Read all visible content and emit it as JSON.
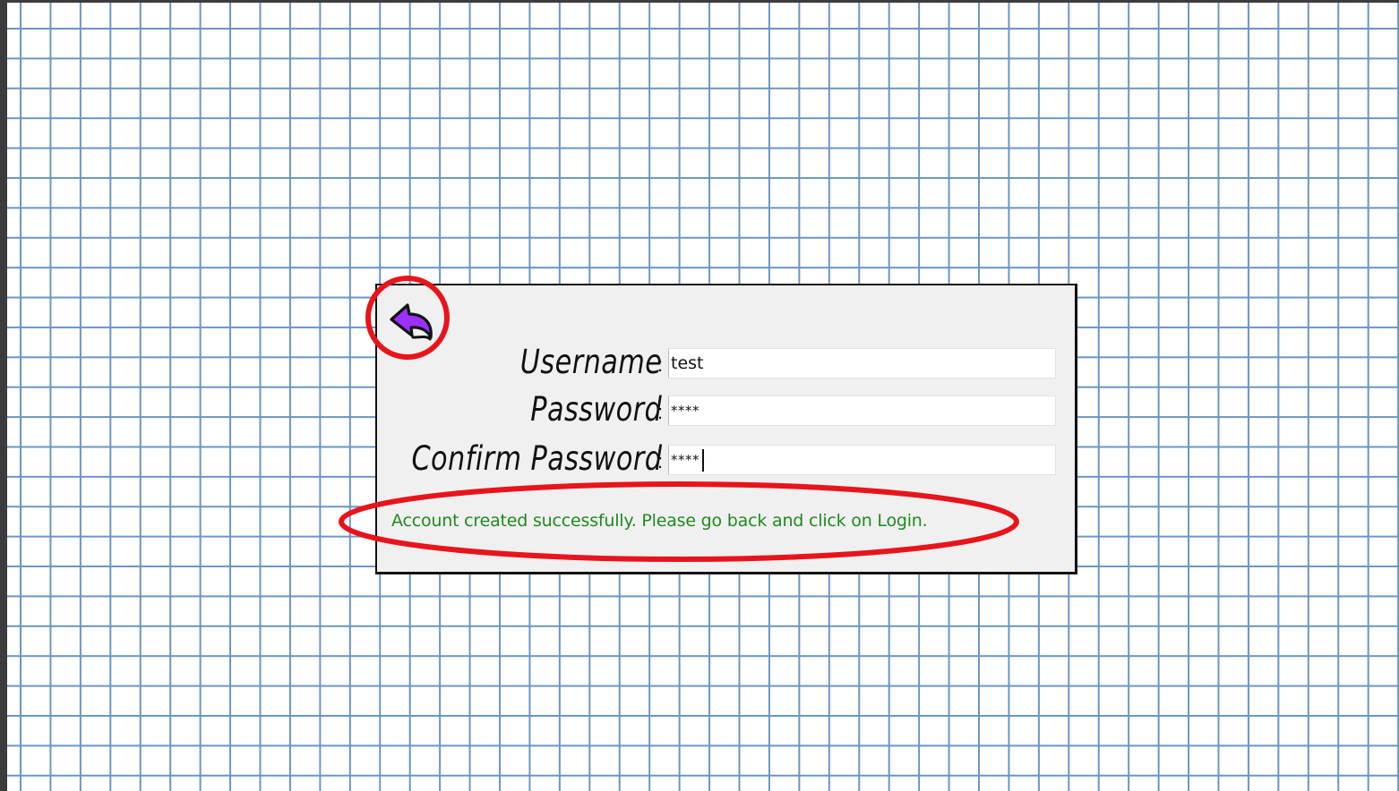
{
  "dialog": {
    "back_button": {
      "icon": "undo-arrow-icon",
      "color": "#9b30ff"
    },
    "fields": [
      {
        "label": "Username",
        "separator": ":",
        "value": "test"
      },
      {
        "label": "Password",
        "separator": ":",
        "value": "****"
      },
      {
        "label": "Confirm Password",
        "separator": ":",
        "value": "****"
      }
    ],
    "status_message": "Account created successfully. Please go back and click on Login.",
    "status_color": "#1e8a1e"
  },
  "annotations": {
    "highlight_color": "#e8141c"
  }
}
